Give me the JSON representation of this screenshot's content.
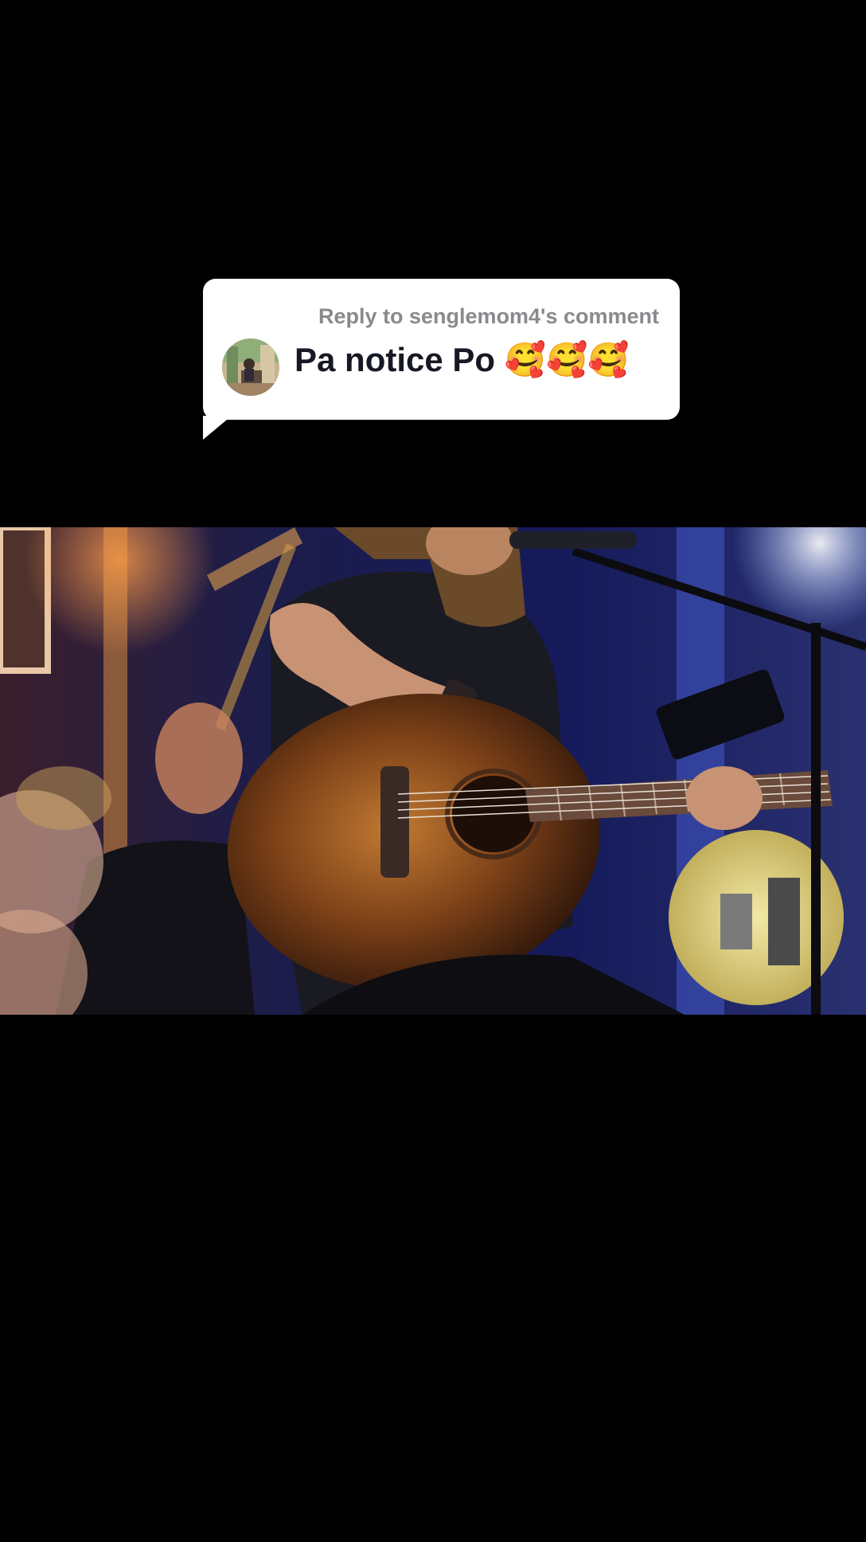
{
  "reply": {
    "header": "Reply to senglemom4's comment",
    "comment": "Pa notice Po 🥰🥰🥰"
  },
  "icons": {
    "avatar": "commenter-avatar",
    "video": "concert-video-frame"
  },
  "colors": {
    "background": "#000000",
    "bubble": "#ffffff",
    "header_text": "#8a8a8e",
    "comment_text": "#161823"
  }
}
